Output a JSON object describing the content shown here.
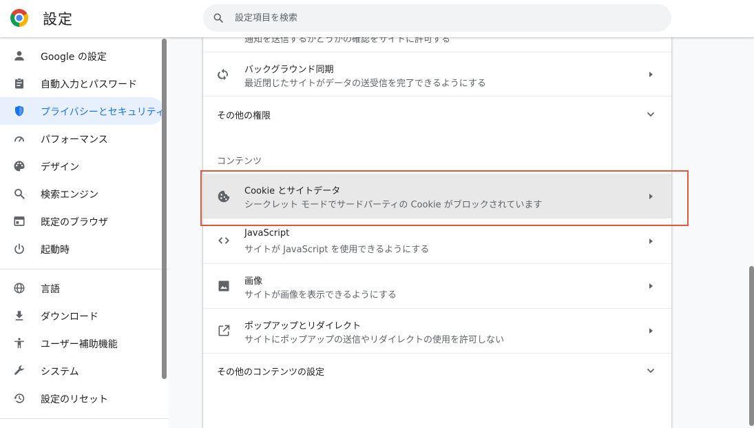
{
  "header": {
    "title": "設定",
    "search_placeholder": "設定項目を検索"
  },
  "sidebar": {
    "items": [
      {
        "label": "Google の設定",
        "icon": "person-icon"
      },
      {
        "label": "自動入力とパスワード",
        "icon": "clipboard-icon"
      },
      {
        "label": "プライバシーとセキュリティ",
        "icon": "shield-icon",
        "active": true
      },
      {
        "label": "パフォーマンス",
        "icon": "speedometer-icon"
      },
      {
        "label": "デザイン",
        "icon": "palette-icon"
      },
      {
        "label": "検索エンジン",
        "icon": "search-icon"
      },
      {
        "label": "既定のブラウザ",
        "icon": "browser-icon"
      },
      {
        "label": "起動時",
        "icon": "power-icon"
      }
    ],
    "advanced_items": [
      {
        "label": "言語",
        "icon": "globe-icon"
      },
      {
        "label": "ダウンロード",
        "icon": "download-icon"
      },
      {
        "label": "ユーザー補助機能",
        "icon": "accessibility-icon"
      },
      {
        "label": "システム",
        "icon": "wrench-icon"
      },
      {
        "label": "設定のリセット",
        "icon": "history-icon"
      }
    ]
  },
  "main": {
    "truncated_text": "通知を送信するかどうかの確認をサイトに許可する",
    "background_sync": {
      "title": "バックグラウンド同期",
      "subtitle": "最近閉じたサイトがデータの送受信を完了できるようにする"
    },
    "other_permissions": "その他の権限",
    "content_section_title": "コンテンツ",
    "content_rows": [
      {
        "title": "Cookie とサイトデータ",
        "subtitle": "シークレット モードでサードパーティの Cookie がブロックされています",
        "icon": "cookie-icon"
      },
      {
        "title": "JavaScript",
        "subtitle": "サイトが JavaScript を使用できるようにする",
        "icon": "code-icon"
      },
      {
        "title": "画像",
        "subtitle": "サイトが画像を表示できるようにする",
        "icon": "image-icon"
      },
      {
        "title": "ポップアップとリダイレクト",
        "subtitle": "サイトにポップアップの送信やリダイレクトの使用を許可しない",
        "icon": "open-in-new-icon"
      }
    ],
    "other_content_settings": "その他のコンテンツの設定"
  },
  "colors": {
    "accent": "#1a73e8",
    "highlight_border": "#e0573e"
  }
}
